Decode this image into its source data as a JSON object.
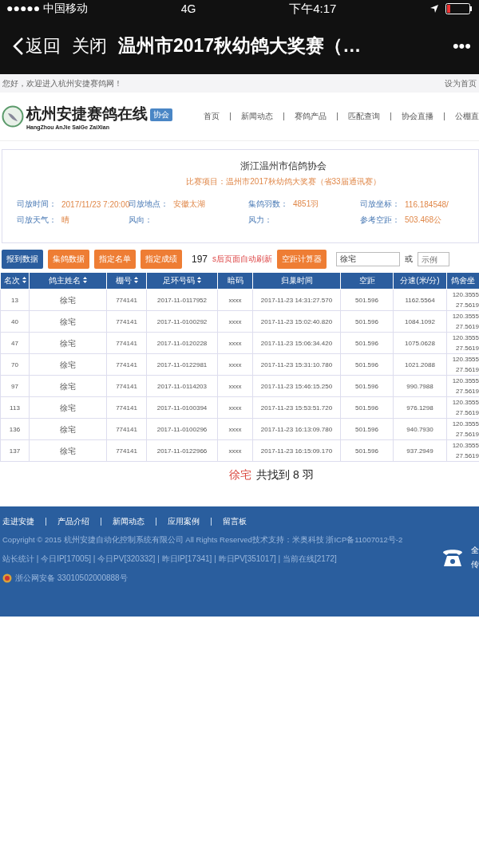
{
  "status_bar": {
    "signal_carrier": "●●●●● 中国移动",
    "network": "4G",
    "time": "下午4:17"
  },
  "nav_bar": {
    "back": "返回",
    "close": "关闭",
    "title": "温州市2017秋幼鸽大奖赛（…",
    "more": "•••"
  },
  "top_strip": {
    "welcome": "您好，欢迎进入杭州安捷赛鸽网！",
    "set_home": "设为首页"
  },
  "header": {
    "logo_text": "杭州安捷赛鸽在线",
    "logo_sub": "HangZhou AnJie SaiGe ZaiXian",
    "badge": "协会",
    "menu": [
      "首页",
      "新闻动态",
      "赛鸽产品",
      "匹配查询",
      "协会直播",
      "公棚直"
    ]
  },
  "race_info": {
    "association": "浙江温州市信鸽协会",
    "race_line": "比赛项目：温州市2017秋幼鸽大奖赛（省33届通讯赛）",
    "fields": [
      {
        "label": "司放时间：",
        "value": "2017/11/23 7:20:00"
      },
      {
        "label": "司放地点：",
        "value": "安徽太湖"
      },
      {
        "label": "集鸽羽数：",
        "value": "4851羽"
      },
      {
        "label": "司放坐标：",
        "value": "116.184548/"
      },
      {
        "label": "司放天气：",
        "value": "晴"
      },
      {
        "label": "风向："
      },
      {
        "label": "风力："
      },
      {
        "label": "参考空距：",
        "value": "503.468公"
      }
    ]
  },
  "toolbar": {
    "tabs": [
      {
        "label": "报到数据",
        "selected": true
      },
      {
        "label": "集鸽数据",
        "selected": false
      },
      {
        "label": "指定名单",
        "selected": false
      },
      {
        "label": "指定成绩",
        "selected": false
      }
    ],
    "countdown": "197",
    "countdown_note": "s后页面自动刷新",
    "calculator": "空距计算器",
    "search_value": "徐宅",
    "or": "或",
    "search2_placeholder": "示例"
  },
  "table": {
    "columns": [
      {
        "label": "名次",
        "sortable": true
      },
      {
        "label": "鸽主姓名",
        "sortable": true
      },
      {
        "label": "棚号",
        "sortable": true
      },
      {
        "label": "足环号码",
        "sortable": true
      },
      {
        "label": "暗码",
        "sortable": false
      },
      {
        "label": "归巢时间",
        "sortable": false
      },
      {
        "label": "空距",
        "sortable": false
      },
      {
        "label": "分速(米/分)",
        "sortable": false
      },
      {
        "label": "鸽舍坐",
        "sortable": false
      }
    ],
    "rows": [
      [
        "13",
        "徐宅",
        "774141",
        "2017-11-0117952",
        "xxxx",
        "2017-11-23 14:31:27.570",
        "501.596",
        "1162.5564",
        "120.3555",
        "27.5619"
      ],
      [
        "40",
        "徐宅",
        "774141",
        "2017-11-0100292",
        "xxxx",
        "2017-11-23 15:02:40.820",
        "501.596",
        "1084.1092",
        "120.3555",
        "27.5619"
      ],
      [
        "47",
        "徐宅",
        "774141",
        "2017-11-0120228",
        "xxxx",
        "2017-11-23 15:06:34.420",
        "501.596",
        "1075.0628",
        "120.3555",
        "27.5619"
      ],
      [
        "70",
        "徐宅",
        "774141",
        "2017-11-0122981",
        "xxxx",
        "2017-11-23 15:31:10.780",
        "501.596",
        "1021.2088",
        "120.3555",
        "27.5619"
      ],
      [
        "97",
        "徐宅",
        "774141",
        "2017-11-0114203",
        "xxxx",
        "2017-11-23 15:46:15.250",
        "501.596",
        "990.7988",
        "120.3555",
        "27.5619"
      ],
      [
        "113",
        "徐宅",
        "774141",
        "2017-11-0100394",
        "xxxx",
        "2017-11-23 15:53:51.720",
        "501.596",
        "976.1298",
        "120.3555",
        "27.5619"
      ],
      [
        "136",
        "徐宅",
        "774141",
        "2017-11-0100296",
        "xxxx",
        "2017-11-23 16:13:09.780",
        "501.596",
        "940.7930",
        "120.3555",
        "27.5619"
      ],
      [
        "137",
        "徐宅",
        "774141",
        "2017-11-0122966",
        "xxxx",
        "2017-11-23 16:15:09.170",
        "501.596",
        "937.2949",
        "120.3555",
        "27.5619"
      ]
    ]
  },
  "result": {
    "name": "徐宅",
    "summary": "共找到 8 羽"
  },
  "footer": {
    "links": [
      "走进安捷",
      "产品介绍",
      "新闻动态",
      "应用案例",
      "留言板"
    ],
    "copyright": "Copyright © 2015 杭州安捷自动化控制系统有限公司 All Rights Reserved技术支持：米奥科技 浙ICP备11007012号-2",
    "stats": "站长统计 | 今日IP[17005] | 今日PV[320332] | 昨日IP[17341] | 昨日PV[351017] | 当前在线[2172]",
    "police": "浙公网安备 33010502000888号",
    "side_line1": "全",
    "side_line2": "传"
  }
}
